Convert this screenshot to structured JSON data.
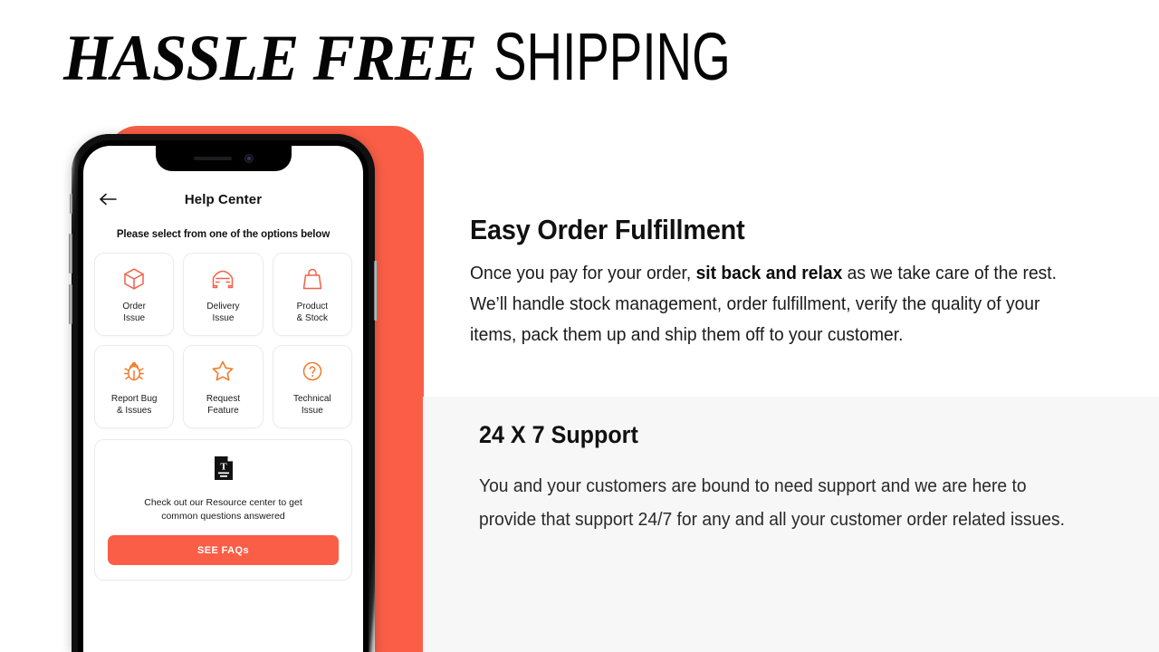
{
  "header": {
    "title_italic": "HASSLE FREE",
    "title_plain": "SHIPPING"
  },
  "colors": {
    "accent_orange": "#FA5E46",
    "icon_orange_row1": "#F4604A",
    "icon_orange_row2": "#F07B2B",
    "support_panel_bg": "#F7F7F7",
    "text_dark": "#111111"
  },
  "phone_app": {
    "back_icon": "back-arrow-icon",
    "title": "Help Center",
    "subtitle": "Please select from one of the options below",
    "options": [
      {
        "label_line1": "Order",
        "label_line2": "Issue",
        "icon": "box-icon"
      },
      {
        "label_line1": "Delivery",
        "label_line2": "Issue",
        "icon": "car-icon"
      },
      {
        "label_line1": "Product",
        "label_line2": "& Stock",
        "icon": "shopping-bag-icon"
      },
      {
        "label_line1": "Report Bug",
        "label_line2": "& Issues",
        "icon": "bug-icon"
      },
      {
        "label_line1": "Request",
        "label_line2": "Feature",
        "icon": "star-icon"
      },
      {
        "label_line1": "Technical",
        "label_line2": "Issue",
        "icon": "question-circle-icon"
      }
    ],
    "resource_card": {
      "icon": "document-text-icon",
      "text_line1": "Check out our Resource center to get",
      "text_line2": "common questions answered",
      "button_label": "SEE FAQs"
    }
  },
  "content": {
    "fulfillment": {
      "heading": "Easy Order Fulfillment",
      "body_part1": "Once you pay for your order, ",
      "body_bold": "sit back and relax",
      "body_part2": " as we take care of the rest. We’ll handle stock management, order fulfillment, verify the quality of your items, pack them up and ship them off to your customer."
    },
    "support": {
      "heading": "24 X 7 Support",
      "body": "You and your customers are bound to need support and we are here to provide that support 24/7 for any and all your customer order related issues."
    }
  }
}
